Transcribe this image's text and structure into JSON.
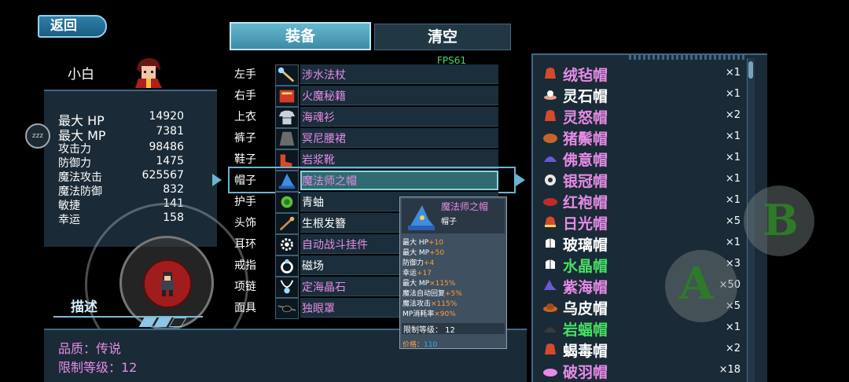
{
  "header": {
    "back_label": "返回"
  },
  "character": {
    "name": "小白"
  },
  "stats": [
    {
      "label": "最大 HP",
      "value": "14920"
    },
    {
      "label": "最大 MP",
      "value": "7381"
    },
    {
      "label": "攻击力",
      "value": "98486"
    },
    {
      "label": "防御力",
      "value": "1475"
    },
    {
      "label": "魔法攻击",
      "value": "625567"
    },
    {
      "label": "魔法防御",
      "value": "832"
    },
    {
      "label": "敏捷",
      "value": "141"
    },
    {
      "label": "幸运",
      "value": "158"
    }
  ],
  "zzz_button": {
    "label": "zzz"
  },
  "description": {
    "tab_label": "描述",
    "quality": "品质：传说",
    "level_limit": "限制等级：12"
  },
  "tabs": {
    "equip": "装备",
    "clear": "清空"
  },
  "fps": "FPS61",
  "equipment": [
    {
      "slot": "左手",
      "name": "涉水法杖",
      "color": "#e68be6"
    },
    {
      "slot": "右手",
      "name": "火魔秘籍",
      "color": "#e68be6"
    },
    {
      "slot": "上衣",
      "name": "海魂衫",
      "color": "#e68be6"
    },
    {
      "slot": "裤子",
      "name": "冥尼腰裙",
      "color": "#e68be6"
    },
    {
      "slot": "鞋子",
      "name": "岩浆靴",
      "color": "#e68be6"
    },
    {
      "slot": "帽子",
      "name": "魔法师之帽",
      "color": "#e68be6"
    },
    {
      "slot": "护手",
      "name": "青蚰",
      "color": "#ffffff"
    },
    {
      "slot": "头饰",
      "name": "生根发簪",
      "color": "#ffffff"
    },
    {
      "slot": "耳环",
      "name": "自动战斗挂件",
      "color": "#e68be6"
    },
    {
      "slot": "戒指",
      "name": "磁场",
      "color": "#ffffff"
    },
    {
      "slot": "项链",
      "name": "定海晶石",
      "color": "#e68be6"
    },
    {
      "slot": "面具",
      "name": "独眼罩",
      "color": "#e68be6"
    }
  ],
  "tooltip": {
    "name": "魔法师之帽",
    "type": "帽子",
    "stats": [
      {
        "label": "最大 HP",
        "bonus": "+10"
      },
      {
        "label": "最大 MP",
        "bonus": "+50"
      },
      {
        "label": "防御力",
        "bonus": "+4"
      },
      {
        "label": "幸运",
        "bonus": "+17"
      },
      {
        "label": "最大 MP",
        "bonus": "×115%"
      },
      {
        "label": "魔法自动回复",
        "bonus": "+5%"
      },
      {
        "label": "魔法攻击",
        "bonus": "×115%"
      },
      {
        "label": "MP消耗率",
        "bonus": "×90%"
      }
    ],
    "level_limit": "限制等级： 12",
    "price_label": "价格：",
    "price_value": "110"
  },
  "hats": [
    {
      "name": "绒毡帽",
      "qty": "×1",
      "color": "#e68be6"
    },
    {
      "name": "灵石帽",
      "qty": "×1",
      "color": "#ffffff"
    },
    {
      "name": "灵怒帽",
      "qty": "×2",
      "color": "#e68be6"
    },
    {
      "name": "猪鬃帽",
      "qty": "×1",
      "color": "#e68be6"
    },
    {
      "name": "佛意帽",
      "qty": "×1",
      "color": "#e68be6"
    },
    {
      "name": "银冠帽",
      "qty": "×1",
      "color": "#e68be6"
    },
    {
      "name": "红袍帽",
      "qty": "×1",
      "color": "#e68be6"
    },
    {
      "name": "日光帽",
      "qty": "×5",
      "color": "#e68be6"
    },
    {
      "name": "玻璃帽",
      "qty": "×1",
      "color": "#ffffff"
    },
    {
      "name": "水晶帽",
      "qty": "×3",
      "color": "#46e063"
    },
    {
      "name": "紫海帽",
      "qty": "×50",
      "color": "#e68be6"
    },
    {
      "name": "乌皮帽",
      "qty": "×5",
      "color": "#ffffff"
    },
    {
      "name": "岩蝠帽",
      "qty": "×1",
      "color": "#46e063"
    },
    {
      "name": "蝎毒帽",
      "qty": "×2",
      "color": "#ffffff"
    },
    {
      "name": "破羽帽",
      "qty": "×18",
      "color": "#e68be6"
    }
  ],
  "buttons": {
    "a": "A",
    "b": "B"
  }
}
